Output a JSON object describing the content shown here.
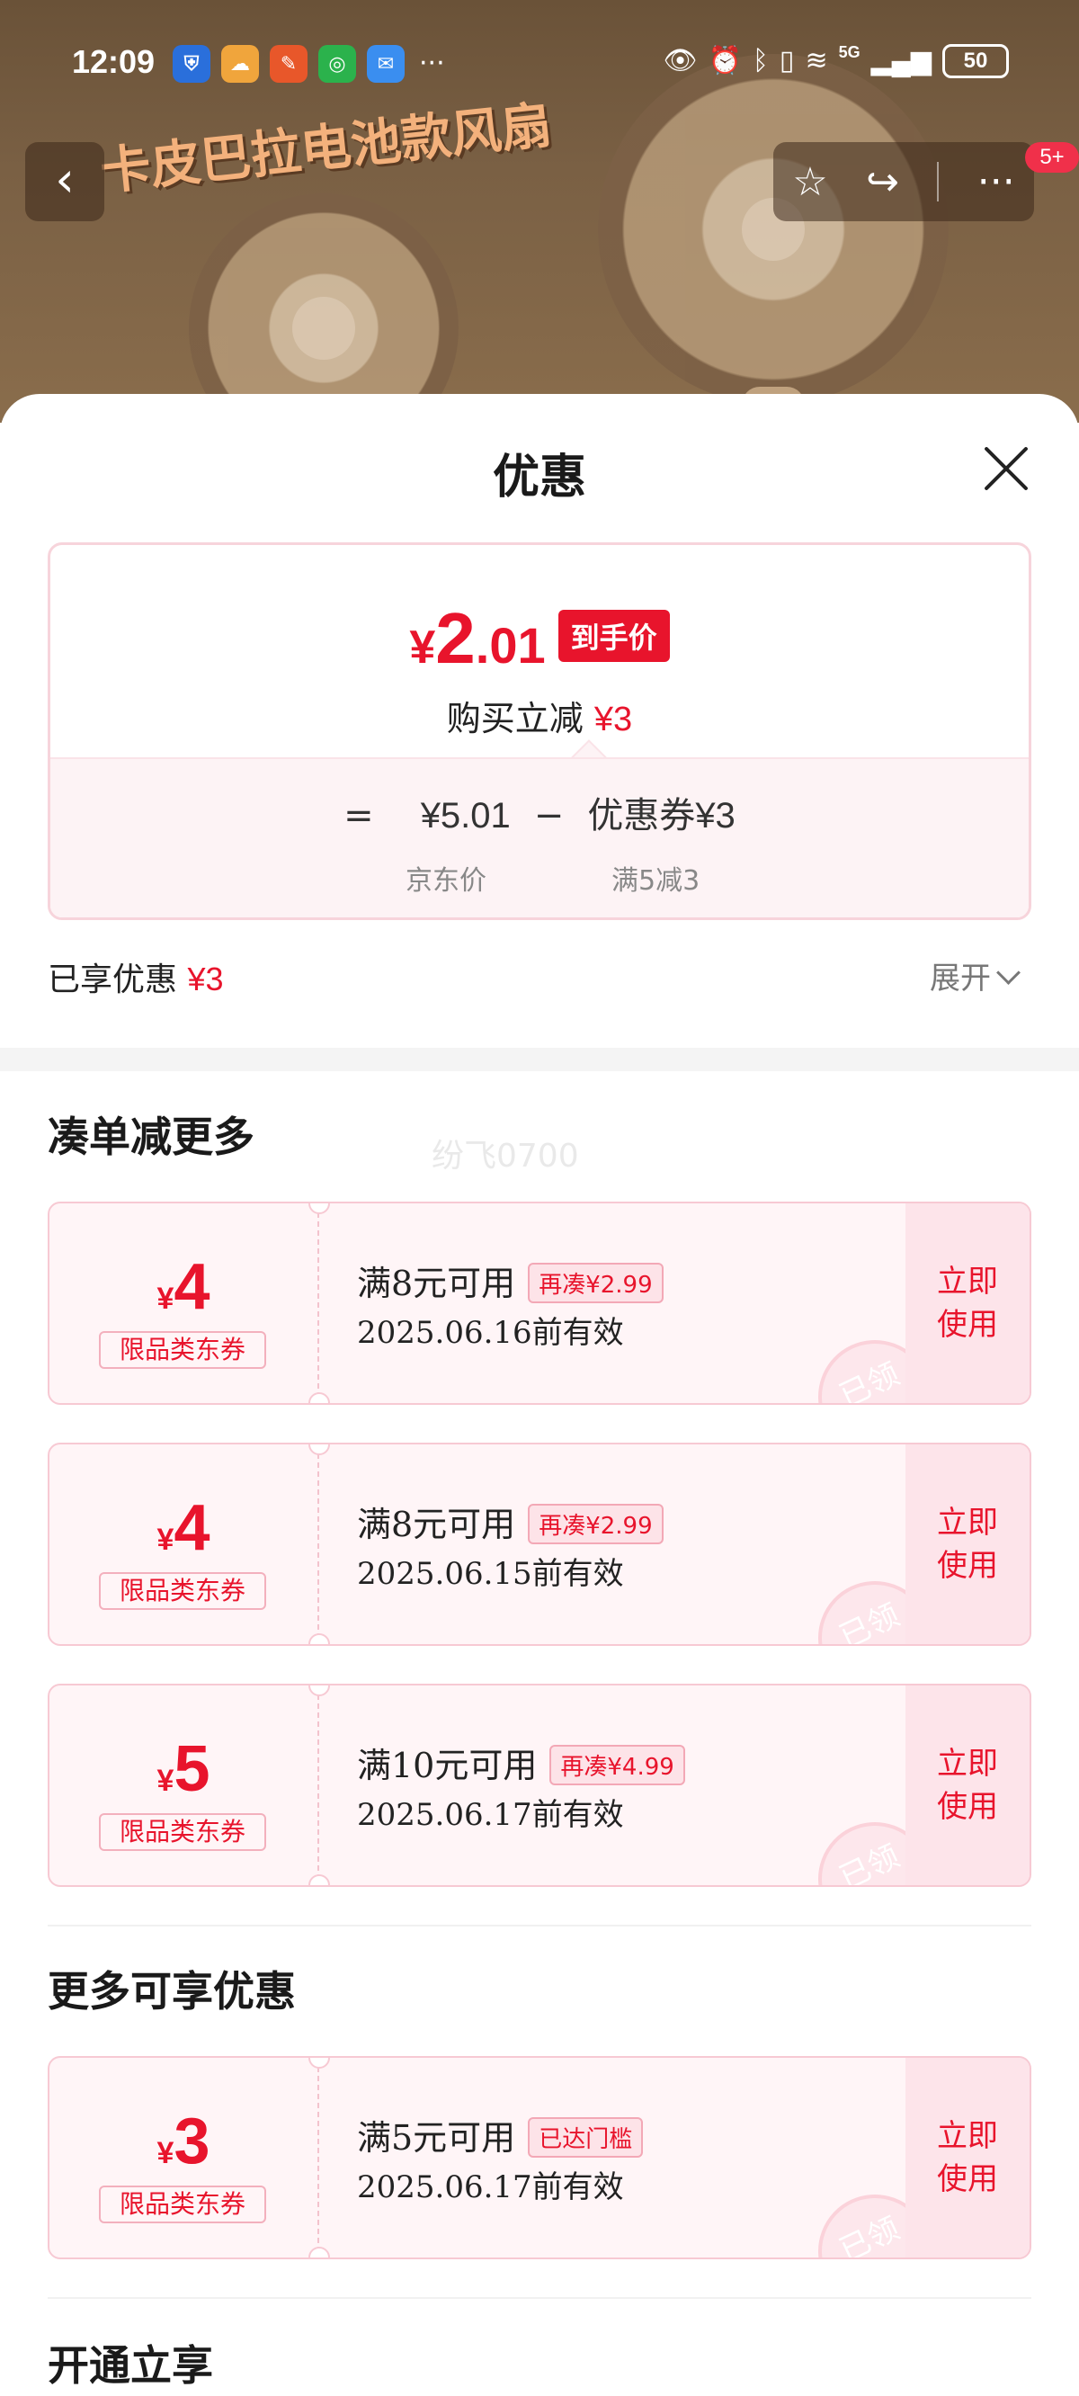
{
  "status_bar": {
    "time": "12:09",
    "network_label": "5G",
    "battery": "50",
    "more": "···"
  },
  "header": {
    "promo_title": "卡皮巴拉电池款风扇",
    "back_icon": "‹",
    "star_icon": "☆",
    "share_icon": "↪",
    "more_icon": "···",
    "message_badge": "5+"
  },
  "sheet": {
    "title": "优惠",
    "price_card": {
      "currency": "¥",
      "final_int": "2",
      "final_dec": ".01",
      "final_tag": "到手价",
      "reduce_label": "购买立减",
      "reduce_value": "¥3",
      "eq": "=",
      "base_price": "¥5.01",
      "minus": "−",
      "coupon_label": "优惠券",
      "coupon_value": "¥3",
      "base_price_label": "京东价",
      "coupon_rule": "满5减3"
    },
    "enjoyed_label": "已享优惠",
    "enjoyed_value": "¥3",
    "expand_label": "展开",
    "watermark": "纷飞0700",
    "sections": [
      {
        "title": "凑单减更多",
        "coupons": [
          {
            "currency": "¥",
            "amount": "4",
            "type": "限品类东券",
            "condition": "满8元可用",
            "tag": "再凑¥2.99",
            "expiry": "2025.06.16前有效",
            "stamp": "已领",
            "action_line1": "立即",
            "action_line2": "使用"
          },
          {
            "currency": "¥",
            "amount": "4",
            "type": "限品类东券",
            "condition": "满8元可用",
            "tag": "再凑¥2.99",
            "expiry": "2025.06.15前有效",
            "stamp": "已领",
            "action_line1": "立即",
            "action_line2": "使用"
          },
          {
            "currency": "¥",
            "amount": "5",
            "type": "限品类东券",
            "condition": "满10元可用",
            "tag": "再凑¥4.99",
            "expiry": "2025.06.17前有效",
            "stamp": "已领",
            "action_line1": "立即",
            "action_line2": "使用"
          }
        ]
      },
      {
        "title": "更多可享优惠",
        "coupons": [
          {
            "currency": "¥",
            "amount": "3",
            "type": "限品类东券",
            "condition": "满5元可用",
            "tag": "已达门槛",
            "expiry": "2025.06.17前有效",
            "stamp": "已领",
            "action_line1": "立即",
            "action_line2": "使用"
          }
        ]
      },
      {
        "title": "开通立享",
        "coupons": []
      }
    ]
  },
  "colors": {
    "accent_red": "#e8142c",
    "coupon_bg": "#fff5f7",
    "coupon_border": "#f7c9d3",
    "header_brown": "#6a5238"
  }
}
